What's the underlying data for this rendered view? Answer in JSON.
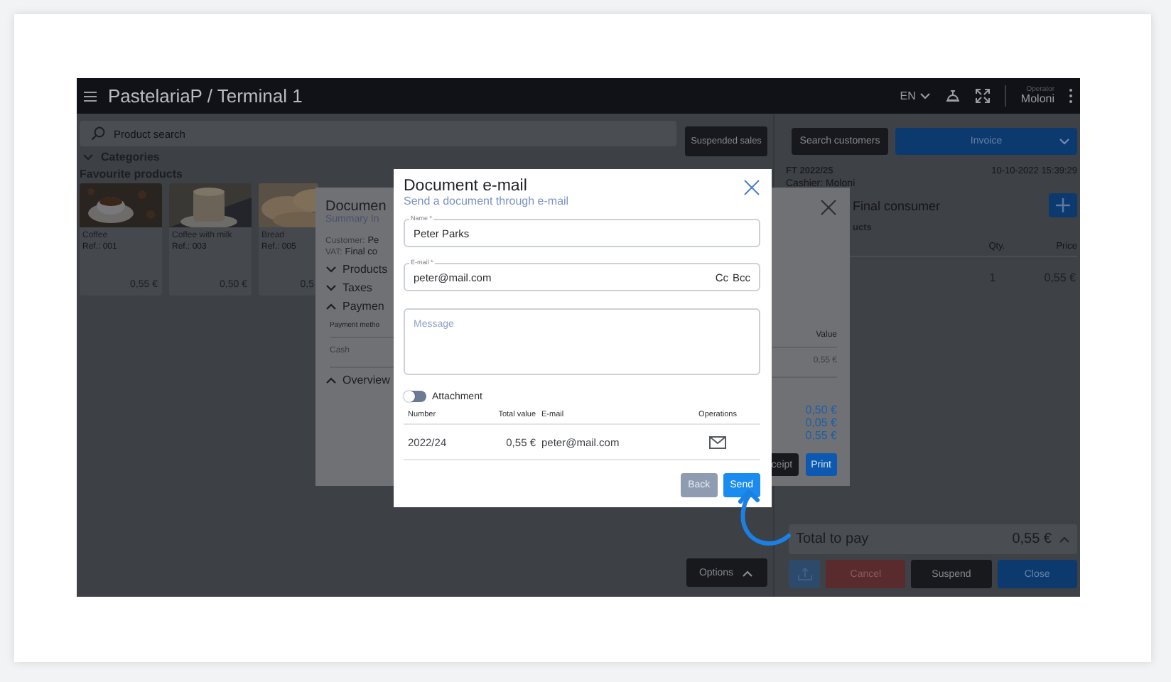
{
  "top_bar": {
    "title": "PastelariaP / Terminal 1",
    "language": "EN",
    "operator_label": "Operator",
    "operator_name": "Moloni"
  },
  "product_panel": {
    "search": {
      "placeholder": "Product search"
    },
    "categories": {
      "label": "Categories",
      "expanded": false
    },
    "section_title": "Favourite products",
    "products": [
      {
        "name": "Coffee",
        "ref": "Ref.: 001",
        "price": "0,55 €",
        "kind": "picture"
      },
      {
        "name": "Coffee with milk",
        "ref": "Ref.: 003",
        "price": "0,50 €",
        "kind": "picture"
      },
      {
        "name": "Bread",
        "ref": "Ref.: 005",
        "price": "0,5",
        "kind": "picture"
      }
    ]
  },
  "middle_column": {
    "suspended_sales": "Suspended sales",
    "options": "Options"
  },
  "sale_panel": {
    "search_customers": "Search customers",
    "document_type": "Invoice",
    "number": "FT 2022/25",
    "date": "10-10-2022 15:39:29",
    "cashier": "Cashier: Moloni",
    "customer": "Final consumer",
    "products_label": "ucts",
    "columns": [
      "Qty.",
      "Price"
    ],
    "lines": [
      {
        "qty": "1",
        "price": "0,55 €"
      }
    ],
    "total_label": "Total to pay",
    "total": "0,55 €",
    "buttons": [
      {
        "label": "Cancel",
        "kind": "danger"
      },
      {
        "label": "Suspend",
        "kind": "dark"
      },
      {
        "label": "Close",
        "kind": "primary"
      }
    ]
  },
  "summary_dialog": {
    "title": "Documen",
    "subtitle": "Summary In",
    "customer_label": "Customer:",
    "customer": "Pe",
    "vat_label": "VAT:",
    "vat": "Final co",
    "sections": [
      {
        "label": "Products",
        "expanded": false
      },
      {
        "label": "Taxes",
        "expanded": false
      },
      {
        "label": "Paymen",
        "expanded": true,
        "table": {
          "columns": [
            "Payment metho",
            "Value"
          ],
          "rows": [
            [
              "Cash",
              "0,55 €"
            ]
          ]
        }
      },
      {
        "label": "Overview",
        "expanded": true,
        "values": [
          "0,50 €",
          "0,05 €",
          "0,55 €"
        ]
      }
    ],
    "buttons": [
      {
        "label": "ceipt",
        "kind": "dark"
      },
      {
        "label": "Print",
        "kind": "primary"
      }
    ]
  },
  "email_dialog": {
    "title": "Document e-mail",
    "subtitle": "Send a document through e-mail",
    "name_field": {
      "label": "Name *",
      "value": "Peter Parks"
    },
    "email_field": {
      "label": "E-mail *",
      "value": "peter@mail.com",
      "extras": [
        "Cc",
        "Bcc"
      ]
    },
    "message_field": {
      "placeholder": "Message"
    },
    "attachment": {
      "label": "Attachment",
      "on": false
    },
    "table": {
      "columns": [
        "Number",
        "Total value",
        "E-mail",
        "Operations"
      ],
      "rows": [
        {
          "number": "2022/24",
          "total": "0,55 €",
          "email": "peter@mail.com"
        }
      ]
    },
    "buttons": [
      {
        "label": "Back",
        "kind": "secondary"
      },
      {
        "label": "Send",
        "kind": "primary"
      }
    ]
  }
}
